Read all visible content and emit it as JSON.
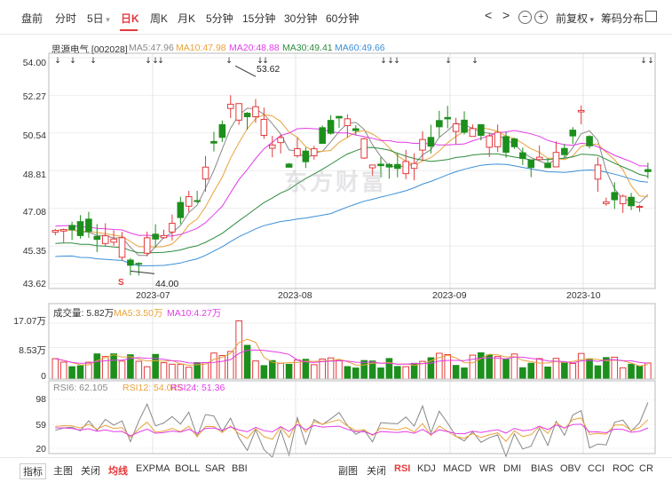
{
  "tabs": [
    "盘前",
    "分时",
    "5日",
    "日K",
    "周K",
    "月K",
    "5分钟",
    "15分钟",
    "30分钟",
    "60分钟"
  ],
  "controls": {
    "prev": "<",
    "next": ">",
    "zoom_out": "−",
    "zoom_in": "+",
    "adjust": "前复权",
    "chip": "筹码分布"
  },
  "legend": {
    "stock": "思源电气 [002028]",
    "ma5": "MA5:47.96",
    "ma10": "MA10:47.98",
    "ma20": "MA20:48.88",
    "ma30": "MA30:49.41",
    "ma60": "MA60:49.66"
  },
  "colors": {
    "up": "#e4393c",
    "down": "#1d8f1d",
    "ma5": "#888888",
    "ma10": "#e8a33b",
    "ma20": "#e33ce8",
    "ma30": "#2e8b3e",
    "ma60": "#3b8fd8"
  },
  "price_axis": [
    "54.00",
    "52.27",
    "50.54",
    "48.81",
    "47.08",
    "45.35",
    "43.62"
  ],
  "dates": [
    "2023-07",
    "2023-08",
    "2023-09",
    "2023-10"
  ],
  "annotations": {
    "high": "53.62",
    "low": "44.00",
    "s_marker": "S"
  },
  "volume": {
    "legend_label": "成交量: 5.82万",
    "ma5": "MA5:3.50万",
    "ma10": "MA10:4.27万",
    "axis": [
      "17.07万",
      "8.53万",
      "0"
    ]
  },
  "rsi": {
    "rsi6": "RSI6: 62.105",
    "rsi12": "RSI12: 54.045",
    "rsi24": "RSI24: 51.36",
    "axis": [
      "98",
      "59",
      "20"
    ]
  },
  "watermark": "东方财富",
  "bottom_left": [
    "指标",
    "主图",
    "关闭",
    "均线",
    "EXPMA",
    "BOLL",
    "SAR",
    "BBI"
  ],
  "bottom_right": [
    "副图",
    "关闭",
    "RSI",
    "KDJ",
    "MACD",
    "WR",
    "DMI",
    "BIAS",
    "OBV",
    "CCI",
    "ROC",
    "CR"
  ]
}
